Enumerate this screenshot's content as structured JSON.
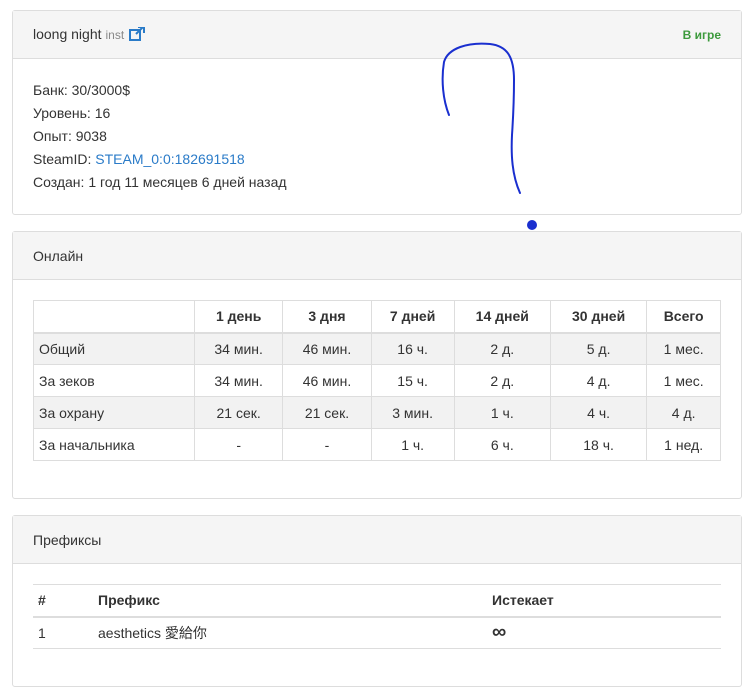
{
  "profile": {
    "name": "loong night",
    "tag": "inst",
    "status": "В игре",
    "colors": {
      "status": "#3c9a3c",
      "link": "#2a7bc8"
    },
    "info": {
      "bank": "Банк: 30/3000$",
      "level": "Уровень: 16",
      "exp": "Опыт: 9038",
      "steamid_label": "SteamID: ",
      "steamid_value": "STEAM_0:0:182691518",
      "created": "Создан: 1 год 11 месяцев 6 дней назад"
    }
  },
  "online": {
    "title": "Онлайн",
    "columns": [
      "",
      "1 день",
      "3 дня",
      "7 дней",
      "14 дней",
      "30 дней",
      "Всего"
    ],
    "rows": [
      [
        "Общий",
        "34 мин.",
        "46 мин.",
        "16 ч.",
        "2 д.",
        "5 д.",
        "1 мес."
      ],
      [
        "За зеков",
        "34 мин.",
        "46 мин.",
        "15 ч.",
        "2 д.",
        "4 д.",
        "1 мес."
      ],
      [
        "За охрану",
        "21 сек.",
        "21 сек.",
        "3 мин.",
        "1 ч.",
        "4 ч.",
        "4 д."
      ],
      [
        "За начальника",
        "-",
        "-",
        "1 ч.",
        "6 ч.",
        "18 ч.",
        "1 нед."
      ]
    ]
  },
  "prefixes": {
    "title": "Префиксы",
    "columns": [
      "#",
      "Префикс",
      "Истекает"
    ],
    "rows": [
      [
        "1",
        "aesthetics 愛給你",
        "∞"
      ]
    ]
  }
}
